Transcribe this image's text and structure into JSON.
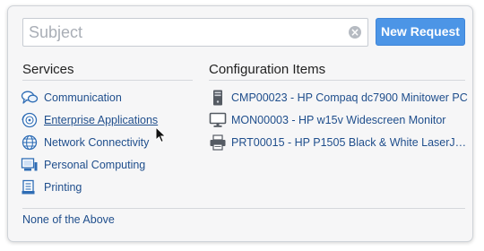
{
  "search": {
    "placeholder": "Subject",
    "value": ""
  },
  "new_request_label": "New Request",
  "services": {
    "title": "Services",
    "items": [
      {
        "label": "Communication",
        "icon": "chat-bubbles-icon"
      },
      {
        "label": "Enterprise Applications",
        "icon": "app-disc-icon"
      },
      {
        "label": "Network Connectivity",
        "icon": "globe-icon"
      },
      {
        "label": "Personal Computing",
        "icon": "computer-icon"
      },
      {
        "label": "Printing",
        "icon": "document-icon"
      }
    ]
  },
  "config_items": {
    "title": "Configuration Items",
    "items": [
      {
        "label": "CMP00023 - HP Compaq dc7900 Minitower PC",
        "icon": "tower-pc-icon"
      },
      {
        "label": "MON00003 - HP w15v Widescreen Monitor",
        "icon": "monitor-icon"
      },
      {
        "label": "PRT00015 - HP P1505 Black & White LaserJ…",
        "icon": "printer-icon"
      }
    ]
  },
  "none_of_the_above": "None of the Above",
  "colors": {
    "link": "#1f4e8c",
    "button": "#4c95e6",
    "panel_bg": "#f6f6f7"
  }
}
